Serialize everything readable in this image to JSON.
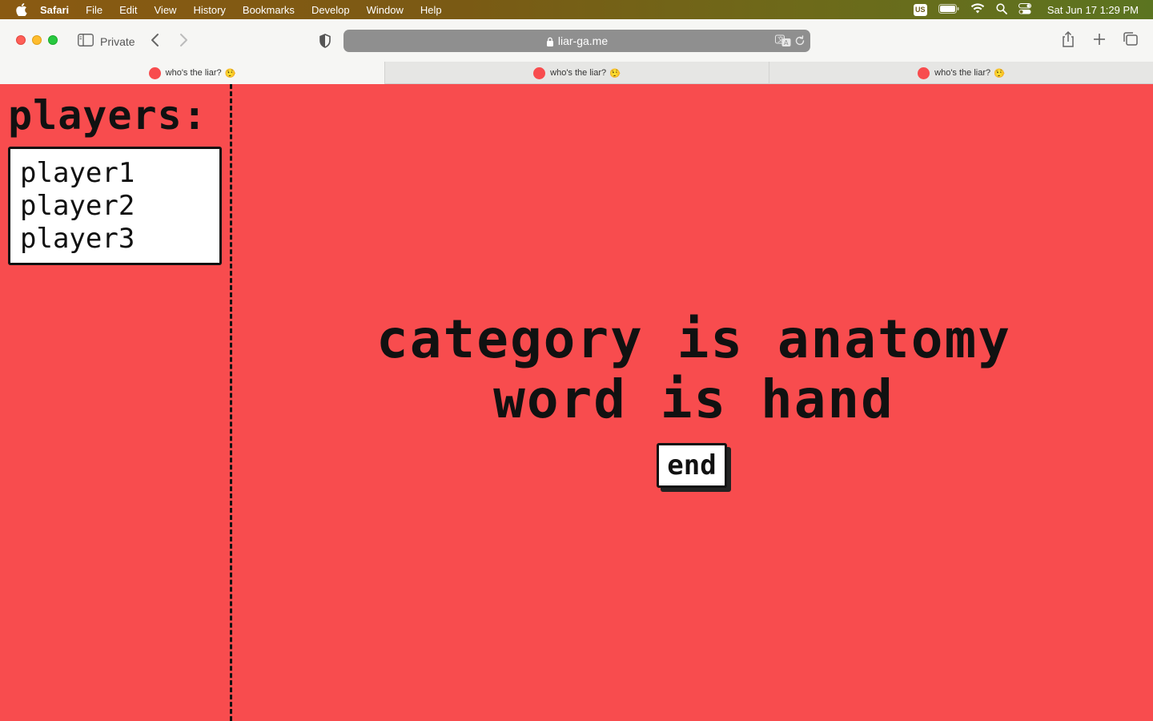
{
  "menubar": {
    "items": [
      "Safari",
      "File",
      "Edit",
      "View",
      "History",
      "Bookmarks",
      "Develop",
      "Window",
      "Help"
    ],
    "input_source": "US",
    "clock": "Sat Jun 17  1:29 PM"
  },
  "toolbar": {
    "sidebar_label": "Private",
    "url": "liar-ga.me"
  },
  "tabs": [
    {
      "title": "who's the liar?",
      "emoji": "🤥"
    },
    {
      "title": "who's the liar?",
      "emoji": "🤥"
    },
    {
      "title": "who's the liar?",
      "emoji": "🤥"
    }
  ],
  "players": {
    "title": "players:",
    "list": [
      "player1",
      "player2",
      "player3"
    ]
  },
  "game": {
    "category_line": "category is anatomy",
    "word_line": "word is hand",
    "end_label": "end"
  },
  "colors": {
    "page_background": "#f84c4e",
    "favicon": "#f84c4e"
  }
}
